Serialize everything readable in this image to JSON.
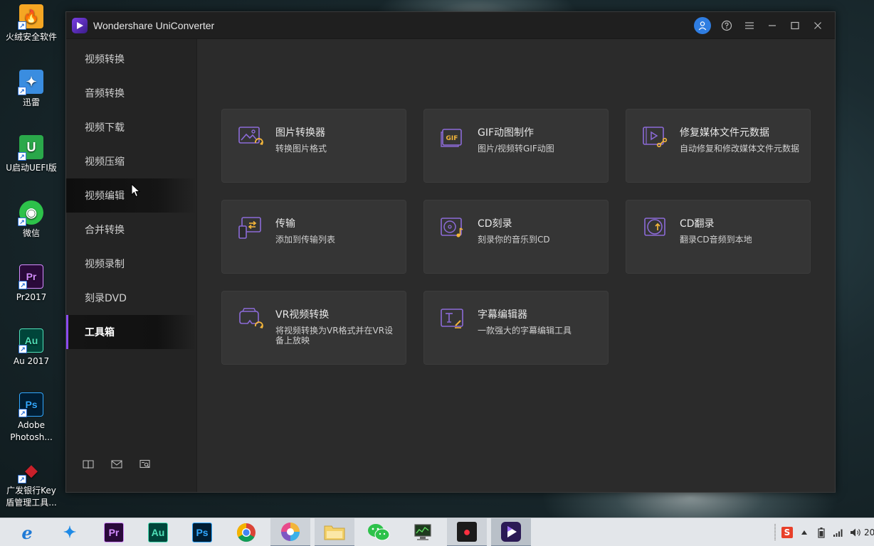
{
  "desktop": {
    "icons": [
      {
        "label": "火绒安全软件",
        "glyph": "🔥",
        "color": "#f0a020"
      },
      {
        "label": "迅雷",
        "glyph": "✦",
        "color": "#3a8de0"
      },
      {
        "label": "U启动UEFI版",
        "glyph": "U",
        "color": "#2aa84a"
      },
      {
        "label": "微信",
        "glyph": "◉",
        "color": "#2dc24a"
      },
      {
        "label": "Pr2017",
        "glyph": "Pr",
        "color": "#2a0a3a"
      },
      {
        "label": "Au 2017",
        "glyph": "Au",
        "color": "#00453a"
      },
      {
        "label": "Adobe Photosh...",
        "glyph": "Ps",
        "color": "#001d33"
      },
      {
        "label": "广发银行Key 盾管理工具...",
        "glyph": "◆",
        "color": "#c8202a"
      }
    ]
  },
  "window": {
    "title": "Wondershare UniConverter",
    "controls": {
      "help": "?",
      "menu": "≡",
      "minimize": "—",
      "maximize": "☐",
      "close": "✕"
    }
  },
  "sidebar": {
    "items": [
      {
        "label": "视频转换",
        "state": "normal"
      },
      {
        "label": "音频转换",
        "state": "normal"
      },
      {
        "label": "视频下载",
        "state": "normal"
      },
      {
        "label": "视频压缩",
        "state": "normal"
      },
      {
        "label": "视频编辑",
        "state": "hover"
      },
      {
        "label": "合并转换",
        "state": "normal"
      },
      {
        "label": "视频录制",
        "state": "normal"
      },
      {
        "label": "刻录DVD",
        "state": "normal"
      },
      {
        "label": "工具箱",
        "state": "active"
      }
    ]
  },
  "tools": [
    {
      "title": "图片转换器",
      "desc": "转换图片格式",
      "icon": "image-convert-icon"
    },
    {
      "title": "GIF动图制作",
      "desc": "图片/视频转GIF动图",
      "icon": "gif-icon"
    },
    {
      "title": "修复媒体文件元数据",
      "desc": "自动修复和修改媒体文件元数据",
      "icon": "metadata-icon"
    },
    {
      "title": "传输",
      "desc": "添加到传输列表",
      "icon": "transfer-icon"
    },
    {
      "title": "CD刻录",
      "desc": "刻录你的音乐到CD",
      "icon": "cd-burn-icon"
    },
    {
      "title": "CD翻录",
      "desc": "翻录CD音频到本地",
      "icon": "cd-rip-icon"
    },
    {
      "title": "VR视频转换",
      "desc": "将视频转换为VR格式并在VR设备上放映",
      "icon": "vr-icon"
    },
    {
      "title": "字幕编辑器",
      "desc": "一款强大的字幕编辑工具",
      "icon": "subtitle-icon"
    }
  ],
  "taskbar": {
    "apps": [
      {
        "name": "edge",
        "glyph": "e",
        "bg": "#ffffff",
        "fg": "#1f7ad6"
      },
      {
        "name": "xunlei",
        "glyph": "✦",
        "bg": "#ffffff",
        "fg": "#1e8ae6"
      },
      {
        "name": "premiere",
        "glyph": "Pr",
        "bg": "#2a0a3a",
        "fg": "#d58cff"
      },
      {
        "name": "audition",
        "glyph": "Au",
        "bg": "#00453a",
        "fg": "#4fe0b8"
      },
      {
        "name": "photoshop",
        "glyph": "Ps",
        "bg": "#001d33",
        "fg": "#31a8ff"
      },
      {
        "name": "chrome",
        "glyph": "◉",
        "bg": "#ffffff",
        "fg": "#dd4b39"
      },
      {
        "name": "pinwheel",
        "glyph": "✺",
        "bg": "#ffffff",
        "fg": "#e84a8a"
      },
      {
        "name": "file-explorer",
        "glyph": "▭",
        "bg": "#f3d067",
        "fg": "#8a6a14"
      },
      {
        "name": "wechat",
        "glyph": "◉",
        "bg": "#ffffff",
        "fg": "#2dc24a"
      },
      {
        "name": "monitor",
        "glyph": "▤",
        "bg": "#ffffff",
        "fg": "#2c6e2c"
      },
      {
        "name": "recorder",
        "glyph": "●",
        "bg": "#1b1b1b",
        "fg": "#ff3040"
      },
      {
        "name": "uniconverter",
        "glyph": "▶",
        "bg": "#2b1a55",
        "fg": "#ffffff"
      }
    ],
    "tray": {
      "ime": "S",
      "clock_partial": "20"
    }
  },
  "colors": {
    "accent": "#8a4bf0",
    "icon_purple": "#8c6bd8",
    "icon_yellow": "#f3b53a"
  }
}
